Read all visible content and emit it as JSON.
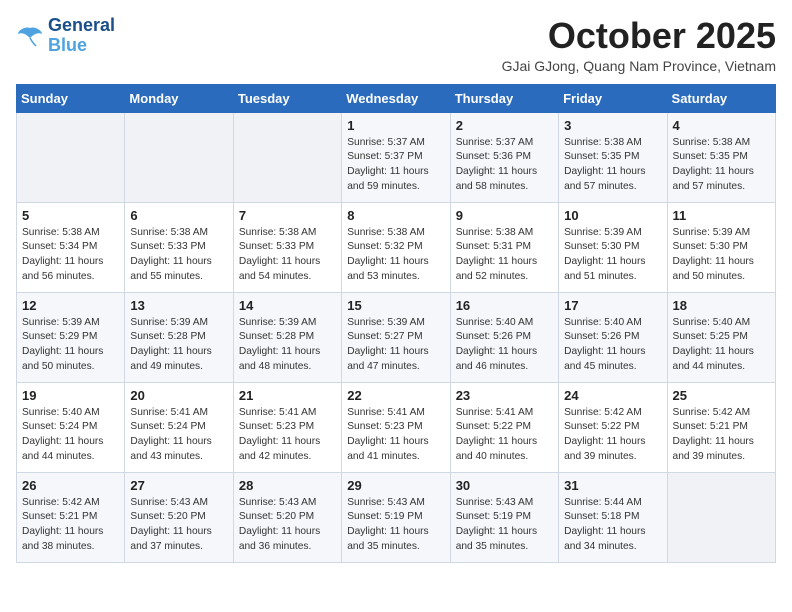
{
  "header": {
    "logo_line1": "General",
    "logo_line2": "Blue",
    "month_title": "October 2025",
    "location": "GJai GJong, Quang Nam Province, Vietnam"
  },
  "weekdays": [
    "Sunday",
    "Monday",
    "Tuesday",
    "Wednesday",
    "Thursday",
    "Friday",
    "Saturday"
  ],
  "weeks": [
    [
      {
        "day": "",
        "info": ""
      },
      {
        "day": "",
        "info": ""
      },
      {
        "day": "",
        "info": ""
      },
      {
        "day": "1",
        "info": "Sunrise: 5:37 AM\nSunset: 5:37 PM\nDaylight: 11 hours\nand 59 minutes."
      },
      {
        "day": "2",
        "info": "Sunrise: 5:37 AM\nSunset: 5:36 PM\nDaylight: 11 hours\nand 58 minutes."
      },
      {
        "day": "3",
        "info": "Sunrise: 5:38 AM\nSunset: 5:35 PM\nDaylight: 11 hours\nand 57 minutes."
      },
      {
        "day": "4",
        "info": "Sunrise: 5:38 AM\nSunset: 5:35 PM\nDaylight: 11 hours\nand 57 minutes."
      }
    ],
    [
      {
        "day": "5",
        "info": "Sunrise: 5:38 AM\nSunset: 5:34 PM\nDaylight: 11 hours\nand 56 minutes."
      },
      {
        "day": "6",
        "info": "Sunrise: 5:38 AM\nSunset: 5:33 PM\nDaylight: 11 hours\nand 55 minutes."
      },
      {
        "day": "7",
        "info": "Sunrise: 5:38 AM\nSunset: 5:33 PM\nDaylight: 11 hours\nand 54 minutes."
      },
      {
        "day": "8",
        "info": "Sunrise: 5:38 AM\nSunset: 5:32 PM\nDaylight: 11 hours\nand 53 minutes."
      },
      {
        "day": "9",
        "info": "Sunrise: 5:38 AM\nSunset: 5:31 PM\nDaylight: 11 hours\nand 52 minutes."
      },
      {
        "day": "10",
        "info": "Sunrise: 5:39 AM\nSunset: 5:30 PM\nDaylight: 11 hours\nand 51 minutes."
      },
      {
        "day": "11",
        "info": "Sunrise: 5:39 AM\nSunset: 5:30 PM\nDaylight: 11 hours\nand 50 minutes."
      }
    ],
    [
      {
        "day": "12",
        "info": "Sunrise: 5:39 AM\nSunset: 5:29 PM\nDaylight: 11 hours\nand 50 minutes."
      },
      {
        "day": "13",
        "info": "Sunrise: 5:39 AM\nSunset: 5:28 PM\nDaylight: 11 hours\nand 49 minutes."
      },
      {
        "day": "14",
        "info": "Sunrise: 5:39 AM\nSunset: 5:28 PM\nDaylight: 11 hours\nand 48 minutes."
      },
      {
        "day": "15",
        "info": "Sunrise: 5:39 AM\nSunset: 5:27 PM\nDaylight: 11 hours\nand 47 minutes."
      },
      {
        "day": "16",
        "info": "Sunrise: 5:40 AM\nSunset: 5:26 PM\nDaylight: 11 hours\nand 46 minutes."
      },
      {
        "day": "17",
        "info": "Sunrise: 5:40 AM\nSunset: 5:26 PM\nDaylight: 11 hours\nand 45 minutes."
      },
      {
        "day": "18",
        "info": "Sunrise: 5:40 AM\nSunset: 5:25 PM\nDaylight: 11 hours\nand 44 minutes."
      }
    ],
    [
      {
        "day": "19",
        "info": "Sunrise: 5:40 AM\nSunset: 5:24 PM\nDaylight: 11 hours\nand 44 minutes."
      },
      {
        "day": "20",
        "info": "Sunrise: 5:41 AM\nSunset: 5:24 PM\nDaylight: 11 hours\nand 43 minutes."
      },
      {
        "day": "21",
        "info": "Sunrise: 5:41 AM\nSunset: 5:23 PM\nDaylight: 11 hours\nand 42 minutes."
      },
      {
        "day": "22",
        "info": "Sunrise: 5:41 AM\nSunset: 5:23 PM\nDaylight: 11 hours\nand 41 minutes."
      },
      {
        "day": "23",
        "info": "Sunrise: 5:41 AM\nSunset: 5:22 PM\nDaylight: 11 hours\nand 40 minutes."
      },
      {
        "day": "24",
        "info": "Sunrise: 5:42 AM\nSunset: 5:22 PM\nDaylight: 11 hours\nand 39 minutes."
      },
      {
        "day": "25",
        "info": "Sunrise: 5:42 AM\nSunset: 5:21 PM\nDaylight: 11 hours\nand 39 minutes."
      }
    ],
    [
      {
        "day": "26",
        "info": "Sunrise: 5:42 AM\nSunset: 5:21 PM\nDaylight: 11 hours\nand 38 minutes."
      },
      {
        "day": "27",
        "info": "Sunrise: 5:43 AM\nSunset: 5:20 PM\nDaylight: 11 hours\nand 37 minutes."
      },
      {
        "day": "28",
        "info": "Sunrise: 5:43 AM\nSunset: 5:20 PM\nDaylight: 11 hours\nand 36 minutes."
      },
      {
        "day": "29",
        "info": "Sunrise: 5:43 AM\nSunset: 5:19 PM\nDaylight: 11 hours\nand 35 minutes."
      },
      {
        "day": "30",
        "info": "Sunrise: 5:43 AM\nSunset: 5:19 PM\nDaylight: 11 hours\nand 35 minutes."
      },
      {
        "day": "31",
        "info": "Sunrise: 5:44 AM\nSunset: 5:18 PM\nDaylight: 11 hours\nand 34 minutes."
      },
      {
        "day": "",
        "info": ""
      }
    ]
  ]
}
